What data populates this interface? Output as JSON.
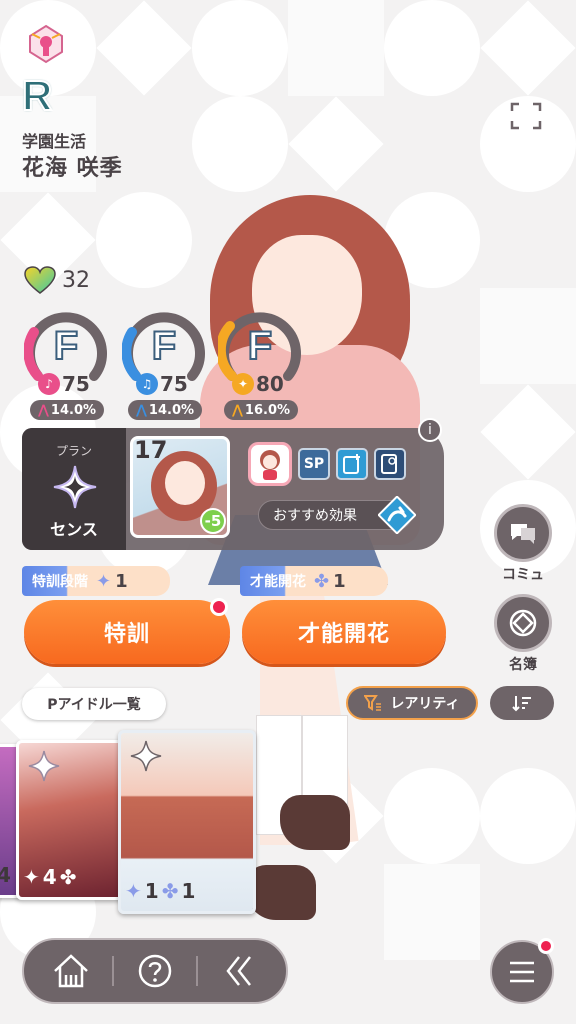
{
  "header": {
    "rarity": "R",
    "card_title": "学園生活",
    "character_name": "花海 咲季"
  },
  "affection": {
    "value": "32"
  },
  "stats": [
    {
      "name": "vocal",
      "grade": "F",
      "value": "75",
      "growth": "14.0%",
      "color": "#e94f8a"
    },
    {
      "name": "dance",
      "grade": "F",
      "value": "75",
      "growth": "14.0%",
      "color": "#3a8fe0"
    },
    {
      "name": "visual",
      "grade": "F",
      "value": "80",
      "growth": "16.0%",
      "color": "#f5a823"
    }
  ],
  "plan": {
    "label": "プラン",
    "name": "センス",
    "support_level": "17",
    "support_cost": "-5",
    "chip_sp": "SP",
    "recommended": "おすすめ効果",
    "info": "i"
  },
  "training": {
    "special_label": "特訓段階",
    "special_value": "1",
    "talent_label": "才能開花",
    "talent_value": "1",
    "special_button": "特訓",
    "talent_button": "才能開花"
  },
  "side": {
    "commu_label": "コミュ",
    "meibo_label": "名簿"
  },
  "list": {
    "idol_list": "Pアイドル一覧",
    "rarity_filter": "レアリティ"
  },
  "cards": [
    {
      "id": "partial",
      "star": "4",
      "bloom": ""
    },
    {
      "id": "second",
      "star": "4",
      "bloom": ""
    },
    {
      "id": "selected",
      "star": "1",
      "bloom": "1"
    }
  ],
  "colors": {
    "accent_orange": "#f7691f",
    "panel": "#6e6468",
    "notify": "#ee2250"
  }
}
